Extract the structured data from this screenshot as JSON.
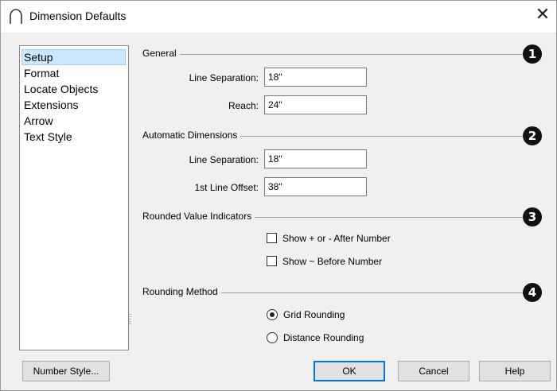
{
  "window": {
    "title": "Dimension Defaults",
    "close_glyph": "✕",
    "icon": "arc-icon"
  },
  "sidebar": {
    "items": [
      {
        "label": "Setup",
        "selected": true
      },
      {
        "label": "Format"
      },
      {
        "label": "Locate Objects"
      },
      {
        "label": "Extensions"
      },
      {
        "label": "Arrow"
      },
      {
        "label": "Text Style"
      }
    ]
  },
  "general": {
    "title": "General",
    "callout": "1",
    "line_separation_label": "Line Separation:",
    "line_separation_value": "18\"",
    "reach_label": "Reach:",
    "reach_value": "24\""
  },
  "automatic": {
    "title": "Automatic Dimensions",
    "callout": "2",
    "line_separation_label": "Line Separation:",
    "line_separation_value": "18\"",
    "offset_label": "1st Line Offset:",
    "offset_value": "38\""
  },
  "rounded": {
    "title": "Rounded Value Indicators",
    "callout": "3",
    "show_plus_minus_label": "Show + or - After Number",
    "show_plus_minus_checked": false,
    "show_tilde_label": "Show ~ Before Number",
    "show_tilde_checked": false
  },
  "rounding": {
    "title": "Rounding Method",
    "callout": "4",
    "grid_label": "Grid Rounding",
    "distance_label": "Distance Rounding",
    "selected": "grid"
  },
  "buttons": {
    "number_style": "Number Style...",
    "ok": "OK",
    "cancel": "Cancel",
    "help": "Help"
  },
  "colors": {
    "accent": "#0078d7",
    "selection_bg": "#cce8ff",
    "callout_bg": "#111111"
  }
}
